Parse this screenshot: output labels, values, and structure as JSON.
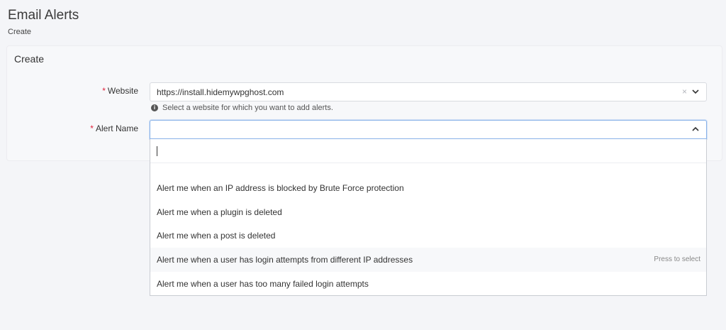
{
  "header": {
    "title": "Email Alerts",
    "subtitle": "Create"
  },
  "card": {
    "title": "Create"
  },
  "form": {
    "website": {
      "label": "Website",
      "value": "https://install.hidemywpghost.com",
      "clear_glyph": "×",
      "help": "Select a website for which you want to add alerts."
    },
    "alert_name": {
      "label": "Alert Name",
      "value": ""
    }
  },
  "dropdown": {
    "search_value": "",
    "options": [
      "Alert me when an IP address is blocked by Brute Force protection",
      "Alert me when a plugin is deleted",
      "Alert me when a post is deleted",
      "Alert me when a user has login attempts from different IP addresses",
      "Alert me when a user has too many failed login attempts"
    ],
    "highlighted_hint": "Press to select"
  },
  "colors": {
    "required": "#e0223a",
    "focus_border": "#8ab2e8"
  },
  "icons": {
    "info": "info-icon",
    "clear": "clear-icon",
    "chevron": "chevron-icon"
  }
}
